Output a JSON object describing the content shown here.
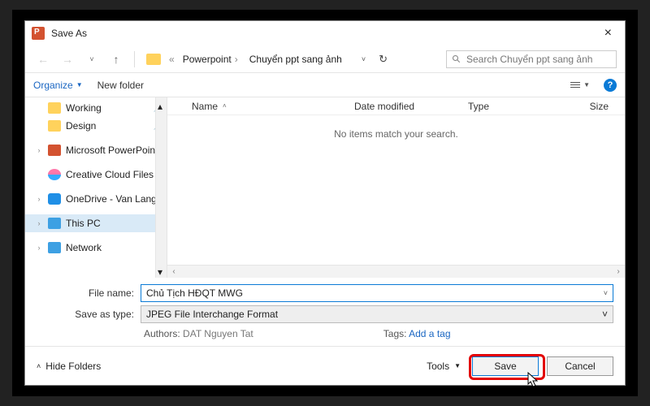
{
  "title": "Save As",
  "breadcrumb": {
    "a": "Powerpoint",
    "b": "Chuyển ppt sang ảnh"
  },
  "search": {
    "placeholder": "Search Chuyển ppt sang ảnh"
  },
  "toolbar": {
    "organize": "Organize",
    "newfolder": "New folder"
  },
  "columns": {
    "name": "Name",
    "dm": "Date modified",
    "type": "Type",
    "size": "Size"
  },
  "empty_msg": "No items match your search.",
  "sidebar": {
    "i0": "Working",
    "i1": "Design",
    "i2": "Microsoft PowerPoint",
    "i3": "Creative Cloud Files",
    "i4": "OneDrive - Van Lang",
    "i5": "This PC",
    "i6": "Network"
  },
  "form": {
    "fn_label": "File name:",
    "fn_value": "Chủ Tịch HĐQT MWG",
    "type_label": "Save as type:",
    "type_value": "JPEG File Interchange Format",
    "authors_label": "Authors:",
    "authors_value": "DAT Nguyen Tat",
    "tags_label": "Tags:",
    "tags_value": "Add a tag"
  },
  "footer": {
    "hide": "Hide Folders",
    "tools": "Tools",
    "save": "Save",
    "cancel": "Cancel"
  }
}
